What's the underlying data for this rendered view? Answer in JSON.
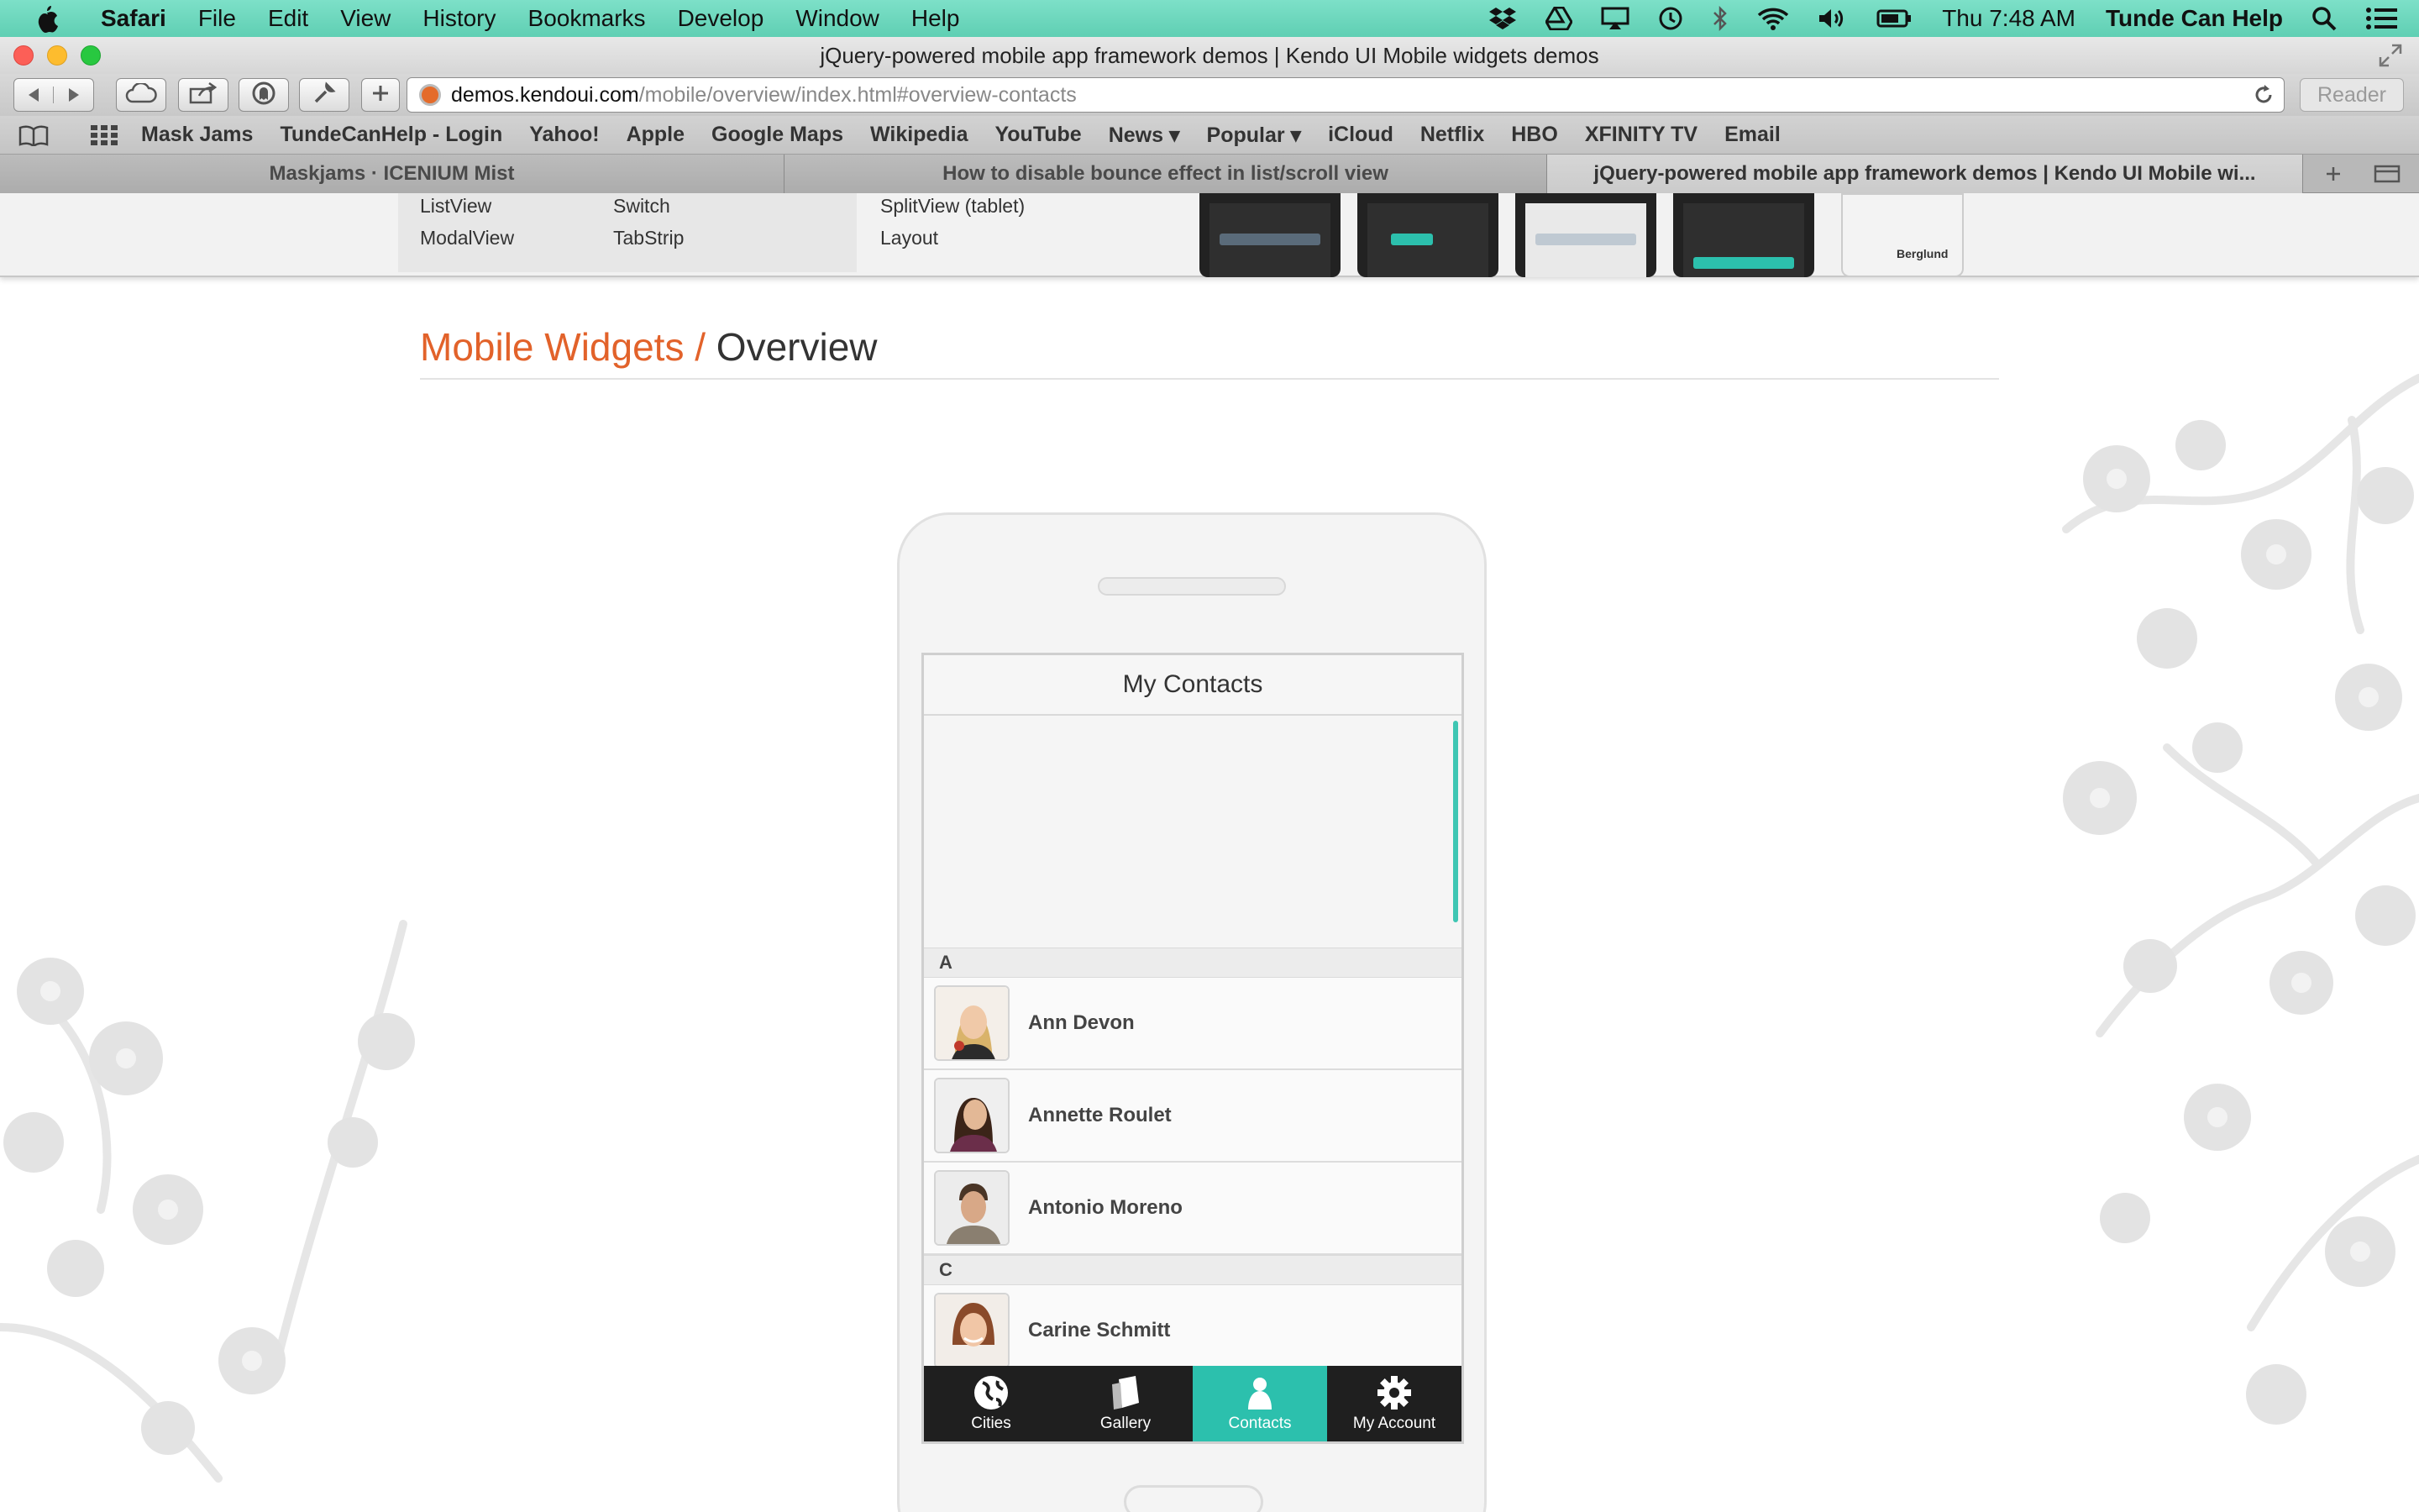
{
  "menubar": {
    "app_name": "Safari",
    "items": [
      "File",
      "Edit",
      "View",
      "History",
      "Bookmarks",
      "Develop",
      "Window",
      "Help"
    ],
    "clock": "Thu 7:48 AM",
    "username": "Tunde Can Help"
  },
  "window": {
    "title": "jQuery-powered mobile app framework demos | Kendo UI Mobile widgets demos"
  },
  "address_bar": {
    "host": "demos.kendoui.com",
    "path": "/mobile/overview/index.html#overview-contacts",
    "reader_label": "Reader"
  },
  "bookmarks": [
    "Mask Jams",
    "TundeCanHelp - Login",
    "Yahoo!",
    "Apple",
    "Google Maps",
    "Wikipedia",
    "YouTube",
    "News ▾",
    "Popular ▾",
    "iCloud",
    "Netflix",
    "HBO",
    "XFINITY TV",
    "Email"
  ],
  "tabs": [
    {
      "title": "Maskjams · ICENIUM Mist"
    },
    {
      "title": "How to disable bounce effect in list/scroll view"
    },
    {
      "title": "jQuery-powered mobile app framework demos | Kendo UI Mobile wi..."
    }
  ],
  "page": {
    "nav_links": {
      "listview": "ListView",
      "modalview": "ModalView",
      "switch": "Switch",
      "tabstrip": "TabStrip",
      "splitview": "SplitView (tablet)",
      "layout": "Layout"
    },
    "thumb_card_name": "Berglund",
    "heading": {
      "crumb": "Mobile Widgets",
      "separator": " / ",
      "current": "Overview"
    }
  },
  "app": {
    "title": "My Contacts",
    "groups": [
      {
        "letter": "A",
        "contacts": [
          "Ann Devon",
          "Annette Roulet",
          "Antonio Moreno"
        ]
      },
      {
        "letter": "C",
        "contacts": [
          "Carine Schmitt"
        ]
      }
    ],
    "tabstrip": [
      {
        "label": "Cities",
        "icon": "globe-icon"
      },
      {
        "label": "Gallery",
        "icon": "gallery-icon"
      },
      {
        "label": "Contacts",
        "icon": "contacts-icon",
        "active": true
      },
      {
        "label": "My Account",
        "icon": "gear-icon"
      }
    ]
  },
  "colors": {
    "accent": "#2cc0ad",
    "crumb": "#e2622a",
    "menubar": "#6fd8bd"
  }
}
